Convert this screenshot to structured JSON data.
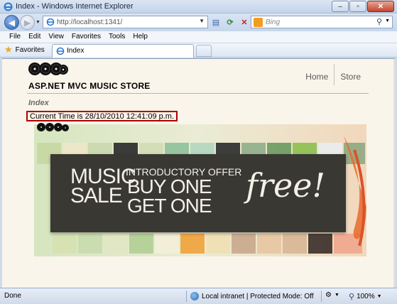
{
  "window": {
    "title": "Index - Windows Internet Explorer",
    "minimize": "–",
    "maximize": "▫",
    "close": "✕"
  },
  "address_bar": {
    "url": "http://localhost:1341/",
    "search_placeholder": "Bing"
  },
  "menu": [
    "File",
    "Edit",
    "View",
    "Favorites",
    "Tools",
    "Help"
  ],
  "favorites_bar": {
    "favorites_label": "Favorites",
    "tab_label": "Index"
  },
  "page": {
    "nav": [
      "Home",
      "Store"
    ],
    "site_name": "ASP.NET MVC MUSIC STORE",
    "heading": "Index",
    "current_time": "Current Time is 28/10/2010 12:41:09 p.m.",
    "promo": {
      "line1_left": "MUSIC",
      "line2_left": "SALE",
      "intro": "INTRODUCTORY OFFER",
      "buy": "BUY ONE",
      "get": "GET ONE",
      "free": "free!"
    }
  },
  "status_bar": {
    "status": "Done",
    "zone": "Local intranet | Protected Mode: Off",
    "zoom": "100%"
  },
  "colors": {
    "highlight_border": "#b00000",
    "page_background": "#f9f5ea",
    "promo_panel": "#3a3833"
  }
}
